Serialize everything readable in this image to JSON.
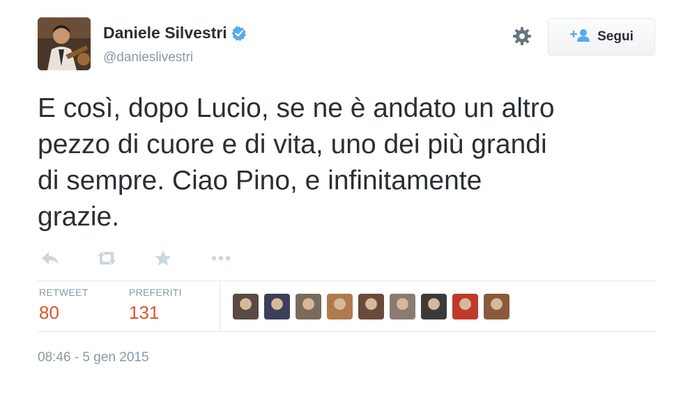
{
  "author": {
    "name": "Daniele Silvestri",
    "handle": "@danieslivestri"
  },
  "follow_button": {
    "label": "Segui"
  },
  "tweet": {
    "lines": [
      "E così, dopo Lucio, se ne è andato un altro",
      "pezzo di cuore e di vita, uno dei più grandi",
      "di sempre. Ciao Pino, e infinitamente",
      "grazie."
    ]
  },
  "actions": [
    "reply-icon",
    "retweet-icon",
    "favorite-icon",
    "more-icon"
  ],
  "stats": {
    "retweet_label": "RETWEET",
    "retweet_count": "80",
    "favorites_label": "PREFERITI",
    "favorites_count": "131"
  },
  "favoriters_avatar_colors": [
    "#5a4a44",
    "#3b3f5c",
    "#7a6a5c",
    "#b07a4c",
    "#6a4a3a",
    "#8a7a72",
    "#3a3a3a",
    "#c0392b",
    "#8a5a3a"
  ],
  "timestamp": "08:46 - 5 gen 2015",
  "colors": {
    "accent": "#d9572c",
    "verified": "#55acee",
    "muted": "#8899a6"
  }
}
